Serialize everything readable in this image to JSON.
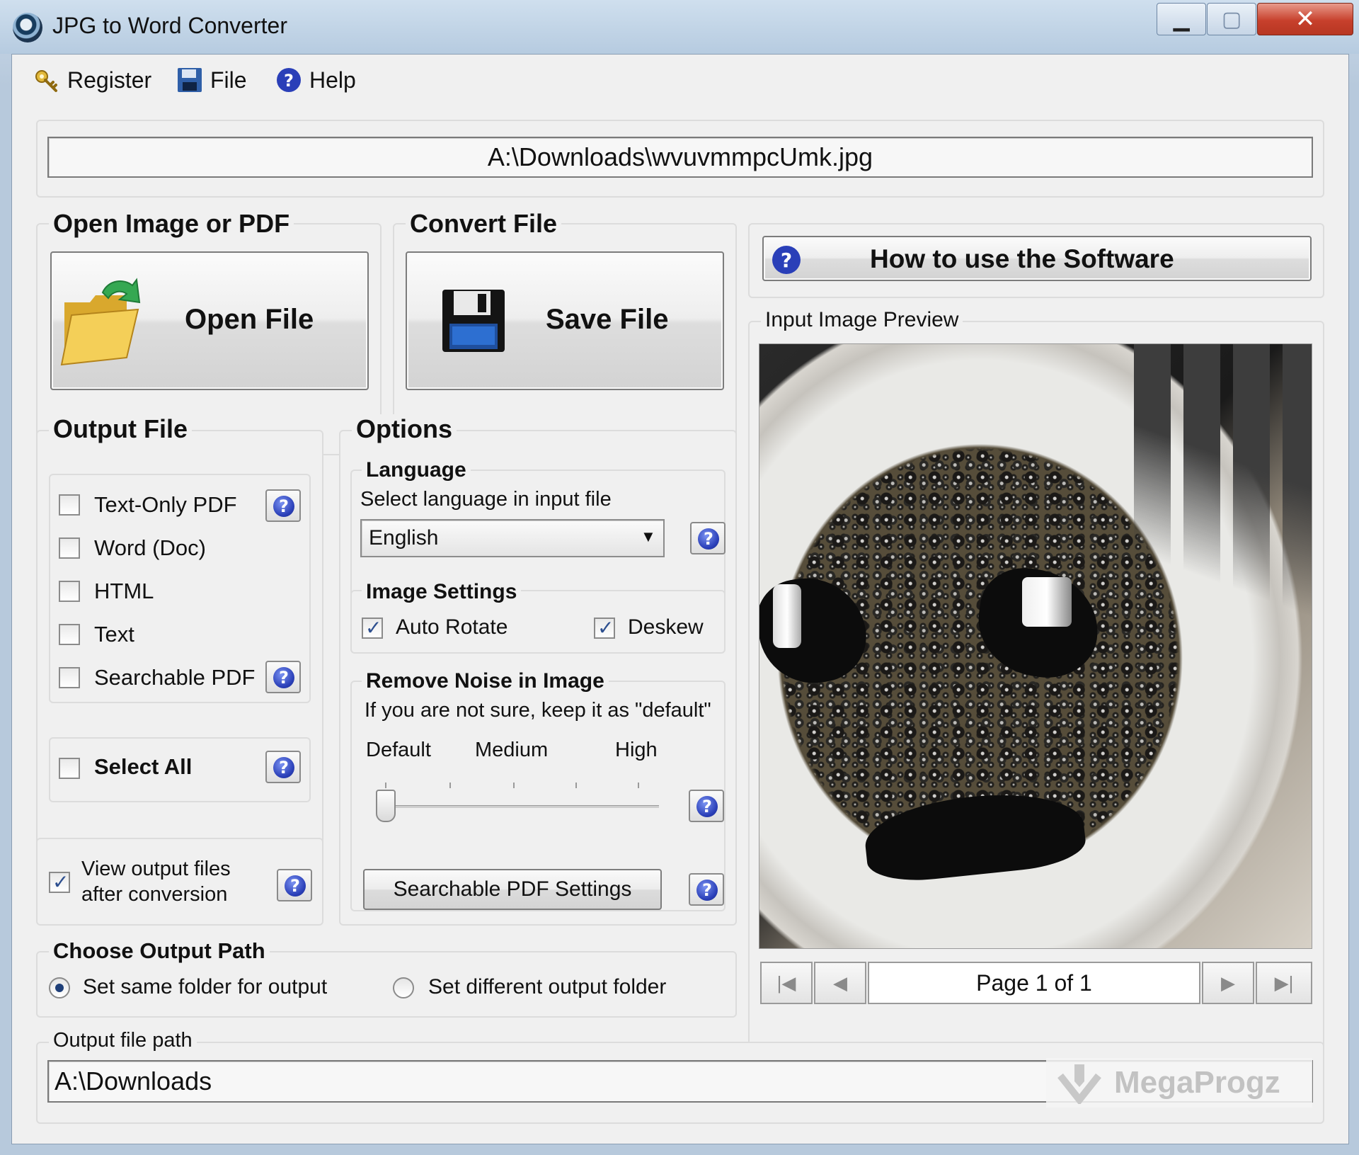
{
  "window": {
    "title": "JPG to Word Converter",
    "min": "▁",
    "max": "▢",
    "close": "✕"
  },
  "menu": [
    {
      "label": "Register",
      "icon": "key-icon"
    },
    {
      "label": "File",
      "icon": "floppy-disk-icon"
    },
    {
      "label": "Help",
      "icon": "help-icon"
    }
  ],
  "input_path": "A:\\Downloads\\wvuvmmpcUmk.jpg",
  "open_group": {
    "title": "Open Image or PDF",
    "button": "Open File"
  },
  "convert_group": {
    "title": "Convert File",
    "button": "Save File"
  },
  "how_to": "How to use the Software",
  "preview": {
    "title": "Input Image Preview",
    "page_text": "Page 1 of 1",
    "nav": {
      "first": "|◀",
      "prev": "◀",
      "next": "▶",
      "last": "▶|"
    }
  },
  "output_file": {
    "title": "Output File",
    "options": [
      {
        "label": "Text-Only PDF",
        "checked": false,
        "help": true
      },
      {
        "label": "Word (Doc)",
        "checked": false,
        "help": false
      },
      {
        "label": "HTML",
        "checked": false,
        "help": false
      },
      {
        "label": "Text",
        "checked": false,
        "help": false
      },
      {
        "label": "Searchable PDF",
        "checked": false,
        "help": true
      }
    ],
    "select_all": "Select All",
    "view_output_line1": "View output files",
    "view_output_line2": "after conversion",
    "view_output_checked": true
  },
  "options": {
    "title": "Options",
    "language": {
      "title": "Language",
      "hint": "Select language in input file",
      "selected": "English"
    },
    "image_settings": {
      "title": "Image Settings",
      "auto_rotate": "Auto Rotate",
      "auto_rotate_checked": true,
      "deskew": "Deskew",
      "deskew_checked": true
    },
    "noise": {
      "title": "Remove Noise in Image",
      "hint": "If you are not sure, keep it as \"default\"",
      "labels": [
        "Default",
        "Medium",
        "High"
      ],
      "level": 0
    },
    "searchable_pdf_settings": "Searchable PDF Settings"
  },
  "output_path": {
    "title": "Choose Output Path",
    "same": "Set same folder for output",
    "different": "Set different output folder",
    "selected": "same",
    "field_label": "Output file path",
    "value": "A:\\Downloads"
  },
  "watermark": "MegaProgz",
  "colors": {
    "help_blue": "#2a3fb8",
    "folder_yellow": "#f2c94c",
    "arrow_green": "#2fa84f"
  }
}
